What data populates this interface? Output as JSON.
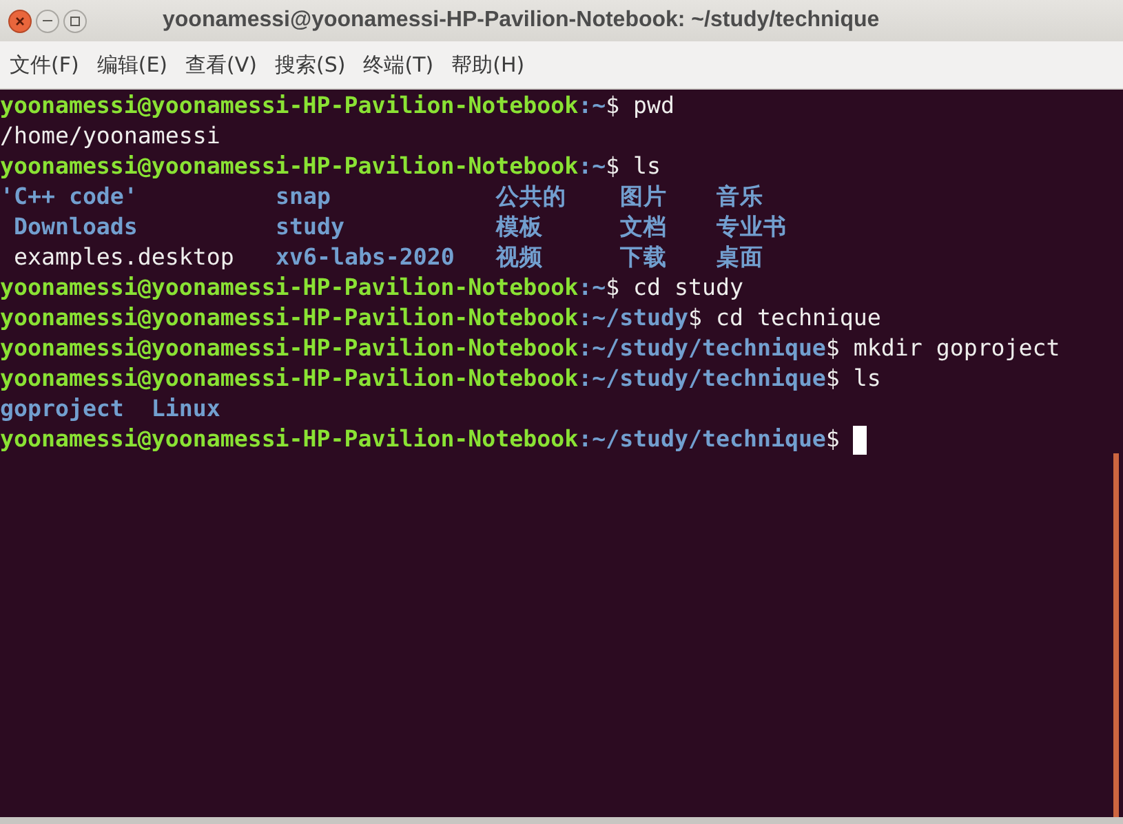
{
  "window": {
    "title": "yoonamessi@yoonamessi-HP-Pavilion-Notebook: ~/study/technique"
  },
  "menu": [
    "文件(F)",
    "编辑(E)",
    "查看(V)",
    "搜索(S)",
    "终端(T)",
    "帮助(H)"
  ],
  "lines": [
    {
      "kind": "prompt",
      "user": "yoonamessi@yoonamessi-HP-Pavilion-Notebook",
      "path": ":~",
      "command": "$ pwd"
    },
    {
      "kind": "output",
      "cells": [
        {
          "text": "/home/yoonamessi",
          "kind": "file"
        }
      ]
    },
    {
      "kind": "prompt",
      "user": "yoonamessi@yoonamessi-HP-Pavilion-Notebook",
      "path": ":~",
      "command": "$ ls"
    },
    {
      "kind": "listing",
      "cells": [
        {
          "text": "'C++ code'",
          "kind": "dir"
        },
        {
          "text": "snap",
          "kind": "dir"
        },
        {
          "text": "公共的",
          "kind": "dir"
        },
        {
          "text": "图片",
          "kind": "dir"
        },
        {
          "text": "音乐",
          "kind": "dir"
        }
      ]
    },
    {
      "kind": "listing",
      "cells": [
        {
          "text": " Downloads",
          "kind": "dir"
        },
        {
          "text": "study",
          "kind": "dir"
        },
        {
          "text": "模板",
          "kind": "dir"
        },
        {
          "text": "文档",
          "kind": "dir"
        },
        {
          "text": "专业书",
          "kind": "dir"
        }
      ]
    },
    {
      "kind": "listing",
      "cells": [
        {
          "text": " examples.desktop",
          "kind": "file"
        },
        {
          "text": "xv6-labs-2020",
          "kind": "dir"
        },
        {
          "text": "视频",
          "kind": "dir"
        },
        {
          "text": "下载",
          "kind": "dir"
        },
        {
          "text": "桌面",
          "kind": "dir"
        }
      ]
    },
    {
      "kind": "prompt",
      "user": "yoonamessi@yoonamessi-HP-Pavilion-Notebook",
      "path": ":~",
      "command": "$ cd study"
    },
    {
      "kind": "prompt",
      "user": "yoonamessi@yoonamessi-HP-Pavilion-Notebook",
      "path": ":~/study",
      "command": "$ cd technique"
    },
    {
      "kind": "prompt",
      "user": "yoonamessi@yoonamessi-HP-Pavilion-Notebook",
      "path": ":~/study/technique",
      "command": "$ mkdir goproject"
    },
    {
      "kind": "prompt",
      "user": "yoonamessi@yoonamessi-HP-Pavilion-Notebook",
      "path": ":~/study/technique",
      "command": "$ ls"
    },
    {
      "kind": "output",
      "cells": [
        {
          "text": "goproject",
          "kind": "dir"
        },
        {
          "text": "Linux",
          "kind": "dir"
        }
      ]
    },
    {
      "kind": "prompt",
      "user": "yoonamessi@yoonamessi-HP-Pavilion-Notebook",
      "path": ":~/study/technique",
      "command": "$",
      "cursor": true
    }
  ]
}
